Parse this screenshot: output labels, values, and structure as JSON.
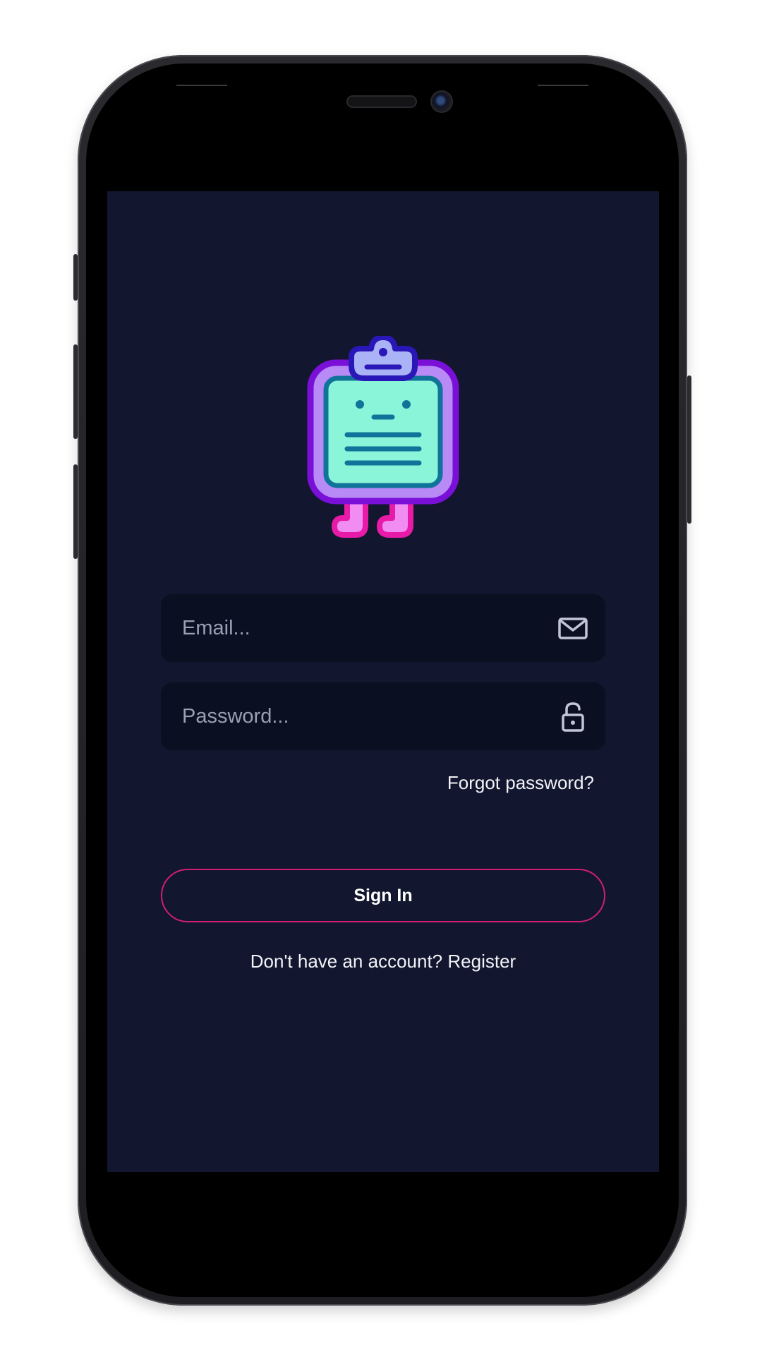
{
  "login": {
    "email_placeholder": "Email...",
    "email_icon": "mail-icon",
    "password_placeholder": "Password...",
    "password_icon": "unlock-icon",
    "forgot_label": "Forgot password?",
    "signin_label": "Sign In",
    "register_prompt": "Don't have an account?",
    "register_link": "Register"
  },
  "logo": {
    "icon": "clipboard-mascot-icon"
  },
  "colors": {
    "screen_background": "#12162e",
    "field_background": "#0b0f22",
    "accent_border": "#d01f72",
    "text": "#f2f3f8",
    "placeholder": "#9a9fb2"
  }
}
